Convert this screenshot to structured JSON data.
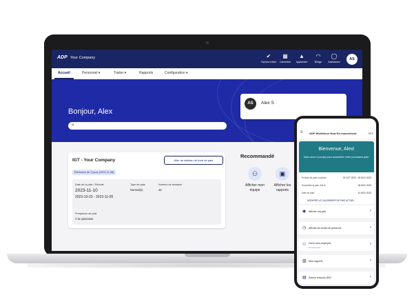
{
  "header": {
    "logo": "ADP",
    "company": "Your Company",
    "icons": [
      {
        "name": "tasks-icon",
        "glyph": "✔",
        "label": "Tâches à faire"
      },
      {
        "name": "calendar-icon",
        "glyph": "▦",
        "label": "Calendrier"
      },
      {
        "name": "learn-icon",
        "glyph": "▲",
        "label": "Apprendre"
      },
      {
        "name": "bridge-icon",
        "glyph": "◠",
        "label": "Bridge"
      },
      {
        "name": "help-icon",
        "glyph": "◯",
        "label": "Assistance"
      }
    ],
    "avatar": "AS"
  },
  "nav": {
    "items": [
      "Accueil",
      "Personnel ▾",
      "Traiter ▾",
      "Rapports",
      "Configuration ▾"
    ]
  },
  "hero": {
    "greeting": "Bonjour, Alex"
  },
  "profile": {
    "initials": "AS",
    "name": "Alex S"
  },
  "igt": {
    "title": "IGT - Your Company",
    "dashboard_button": "Aller au tableau de bord de paie",
    "badge": "Échéance de 2 jours (2023-11-08)",
    "period_label": "Date de la paie / Période",
    "pay_date": "2023-11-10",
    "period_range": "2023-10-23 - 2023-11-05",
    "type_label": "Type de paie",
    "type_value": "Normal(s)",
    "week_label": "Numéro de semaine",
    "week_value": "45",
    "freq_label": "Fréquence de paie",
    "freq_value": "À la quinzaine"
  },
  "recommended": {
    "title": "Recommandé",
    "items": [
      {
        "line1": "Afficher mon",
        "line2": "équipe"
      },
      {
        "line1": "Afficher les",
        "line2": "rapports"
      }
    ]
  },
  "phone": {
    "title": "ADP Workforce Now En mouvement",
    "company": "IGT",
    "welcome": "Bienvenue, Alex!",
    "welcome_sub": "Vous avez 2 jour(s) pour soumettre votre prochaine paie.",
    "rows": [
      {
        "label": "Période de paie courante",
        "value": "23 OCT 2023 - 05 NOV 2023"
      },
      {
        "label": "Soumettre la paie d'ici le",
        "value": "08 NOV 2023"
      },
      {
        "label": "Date de paie",
        "value": "10 NOV 2023"
      }
    ],
    "modify_link": "MODIFIER LE CALENDRIER DE PAIE ACTUEL",
    "items": [
      {
        "title": "Afficher ma paie",
        "sub": ""
      },
      {
        "title": "Afficher les fiches de présence",
        "sub": ""
      },
      {
        "title": "Gérer mes employés",
        "sub": "6 employé(s)"
      },
      {
        "title": "Mes rapports",
        "sub": ""
      },
      {
        "title": "Relevé d'emploi (RE)",
        "sub": ""
      }
    ]
  }
}
